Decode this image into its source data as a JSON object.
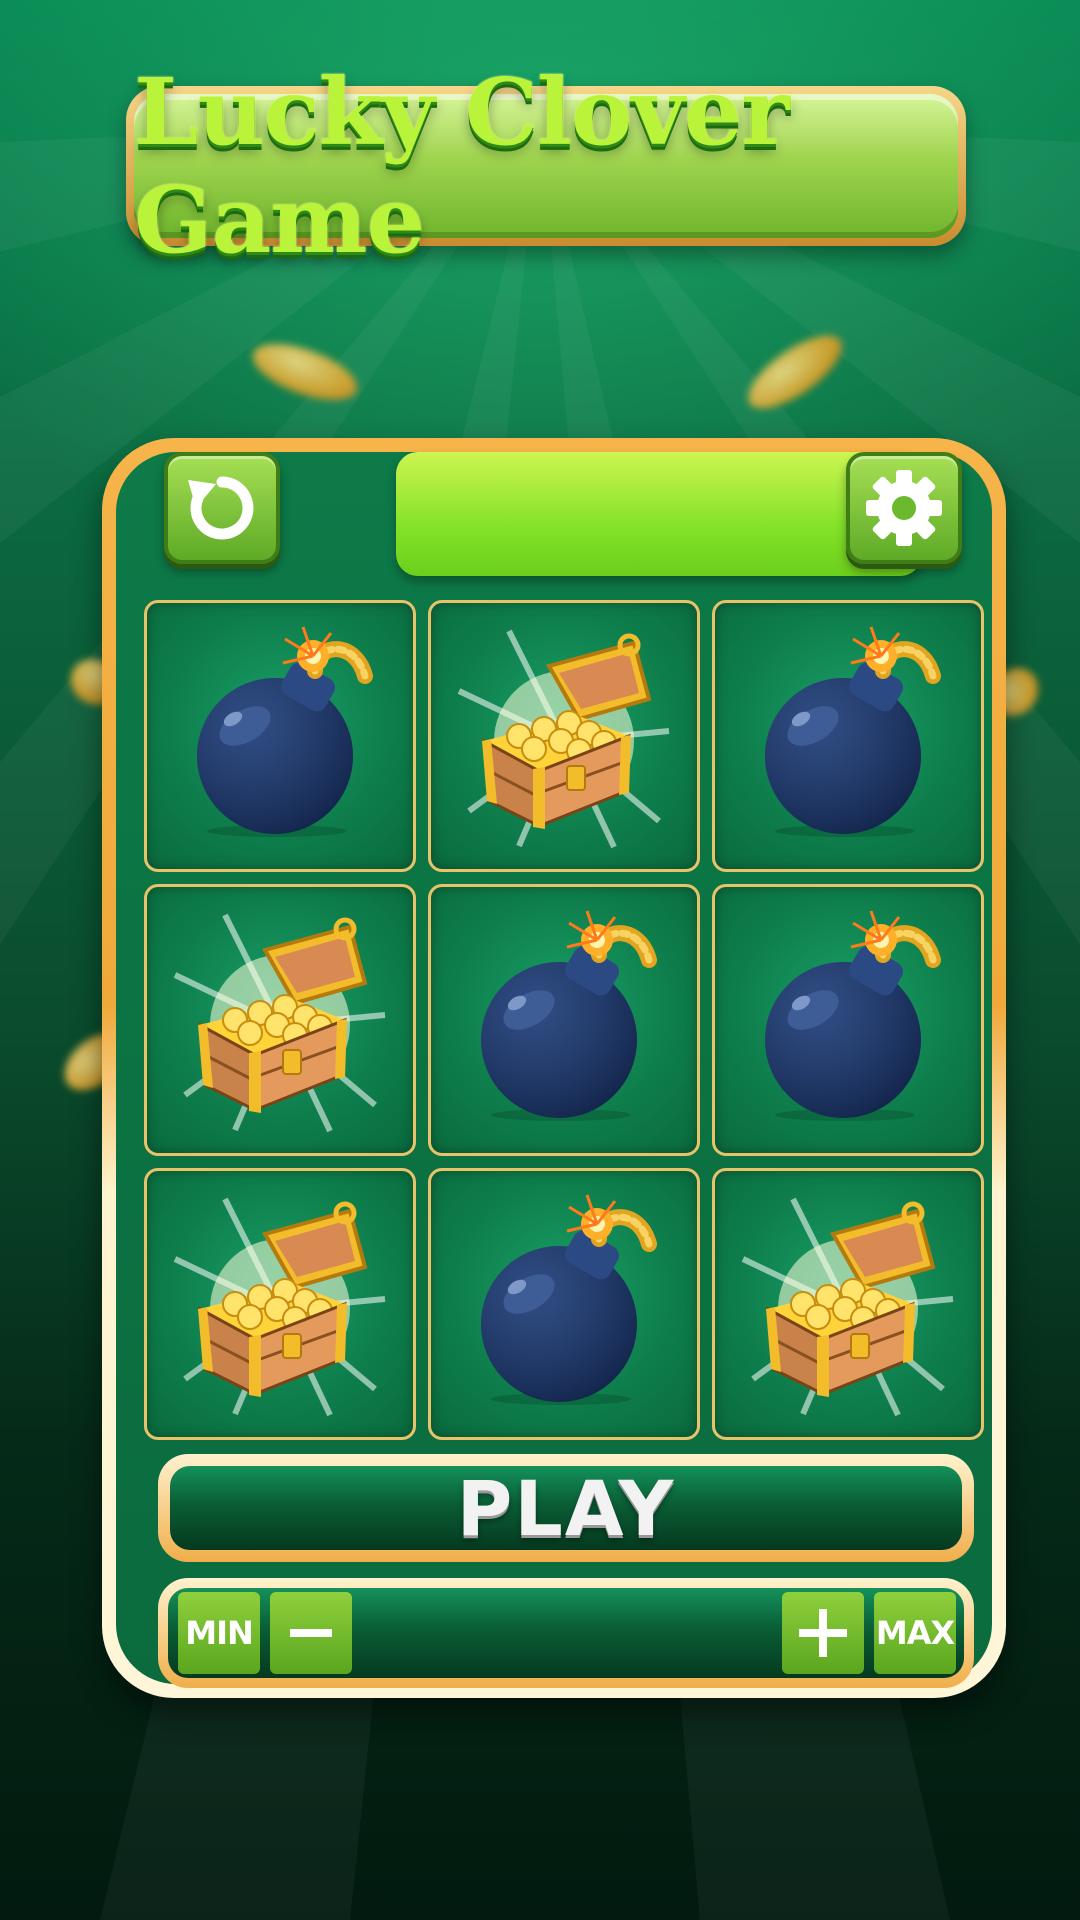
{
  "title": "Lucky Clover Game",
  "toolbar": {
    "undo_icon": "undo-arrow-icon",
    "settings_icon": "gear-icon",
    "status_text": ""
  },
  "grid": {
    "tiles": [
      "bomb",
      "treasure-chest",
      "bomb",
      "treasure-chest",
      "bomb",
      "bomb",
      "treasure-chest",
      "bomb",
      "treasure-chest"
    ]
  },
  "play_button": {
    "label": "PLAY"
  },
  "bet_controls": {
    "min_label": "MIN",
    "max_label": "MAX",
    "decrease_icon": "minus-icon",
    "increase_icon": "plus-icon",
    "value": ""
  },
  "colors": {
    "accent_green": "#84e228",
    "panel_gold": "#f0a83a",
    "bomb_blue": "#1e3a6e"
  }
}
